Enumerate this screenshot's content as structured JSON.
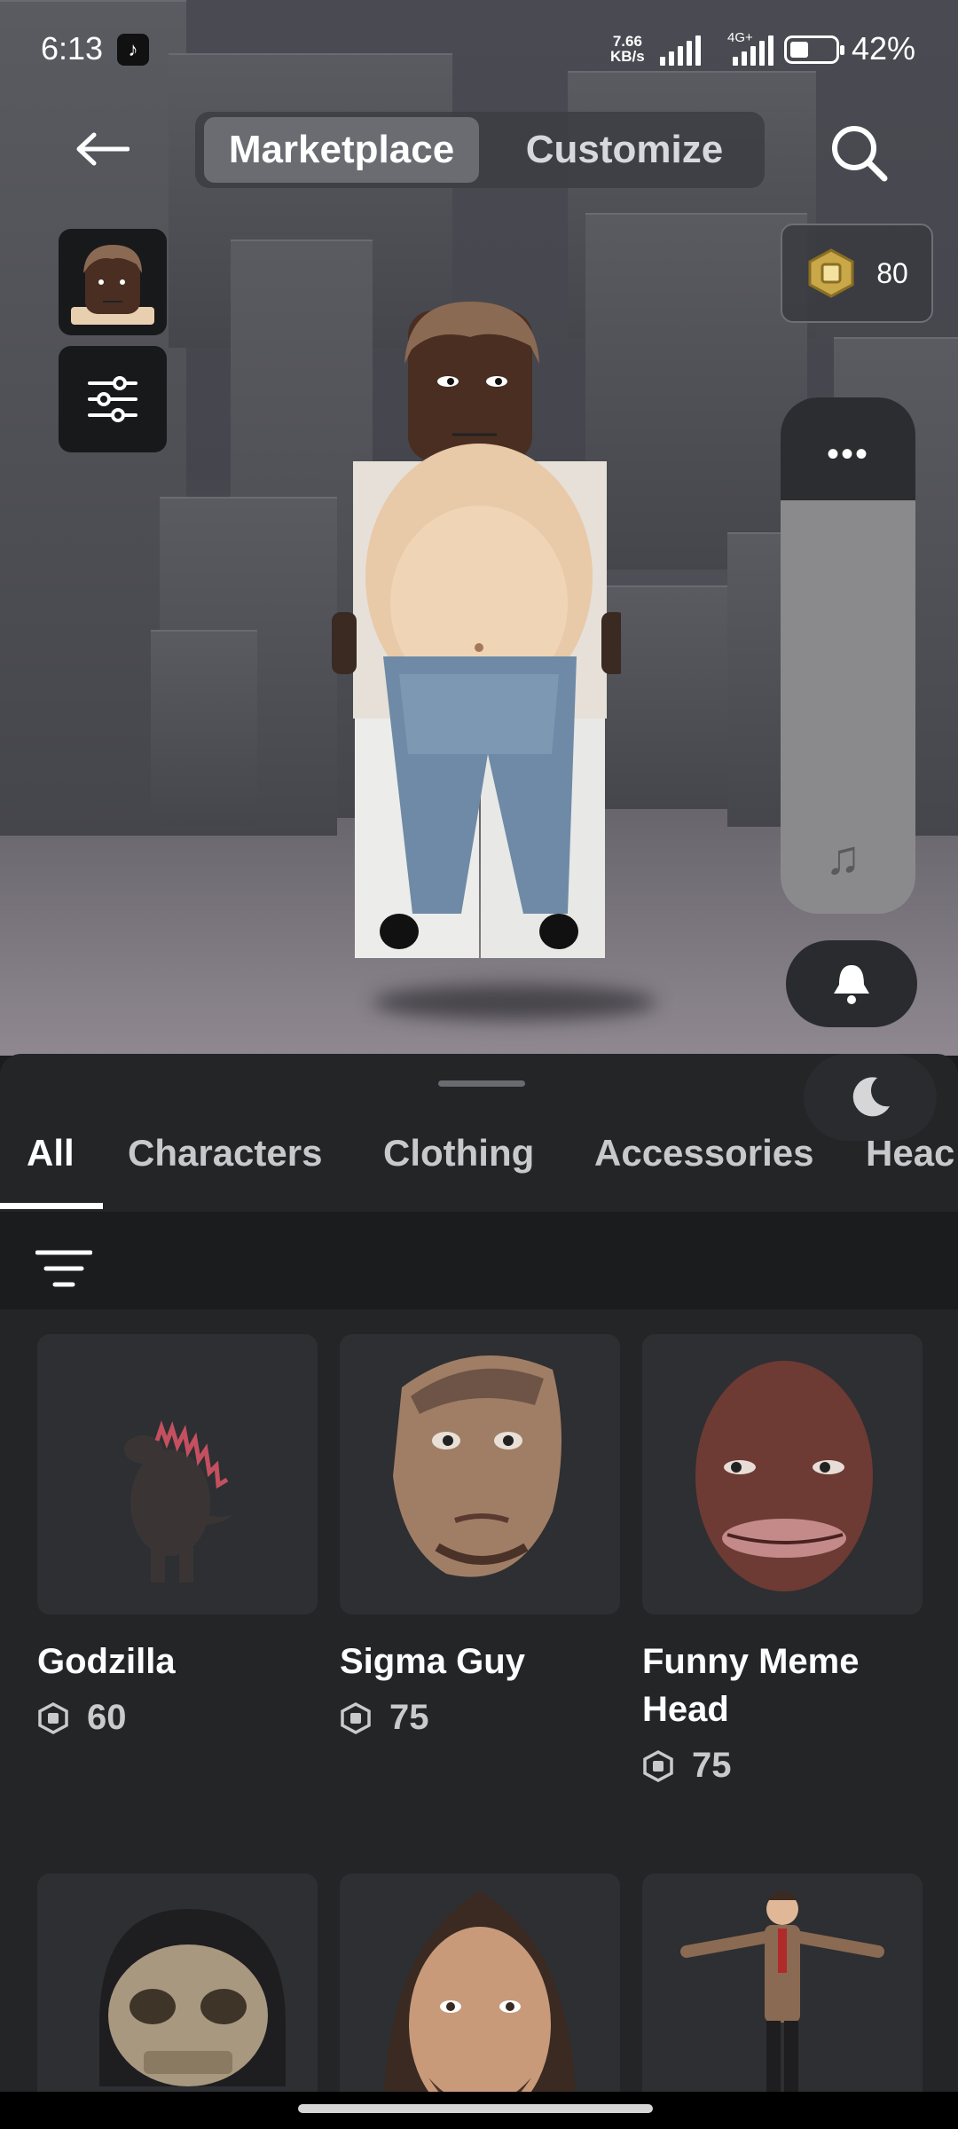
{
  "status_bar": {
    "time": "6:13",
    "net_speed_value": "7.66",
    "net_speed_unit": "KB/s",
    "network_type": "4G+",
    "battery_percent": "42%",
    "battery_level": 0.42
  },
  "header": {
    "tabs": [
      {
        "label": "Marketplace",
        "active": true
      },
      {
        "label": "Customize",
        "active": false
      }
    ]
  },
  "robux_balance": "80",
  "category_tabs": [
    {
      "label": "All",
      "active": true
    },
    {
      "label": "Characters",
      "active": false
    },
    {
      "label": "Clothing",
      "active": false
    },
    {
      "label": "Accessories",
      "active": false
    },
    {
      "label": "Heac",
      "active": false
    }
  ],
  "items": [
    {
      "name": "Godzilla",
      "price": "60"
    },
    {
      "name": "Sigma Guy",
      "price": "75"
    },
    {
      "name": "Funny Meme Head",
      "price": "75"
    },
    {
      "name": "",
      "price": ""
    },
    {
      "name": "",
      "price": ""
    },
    {
      "name": "",
      "price": ""
    }
  ],
  "colors": {
    "background": "#1b1c1e",
    "sheet": "#232527",
    "card": "#2d2f32",
    "accent_text": "#ffffff"
  }
}
